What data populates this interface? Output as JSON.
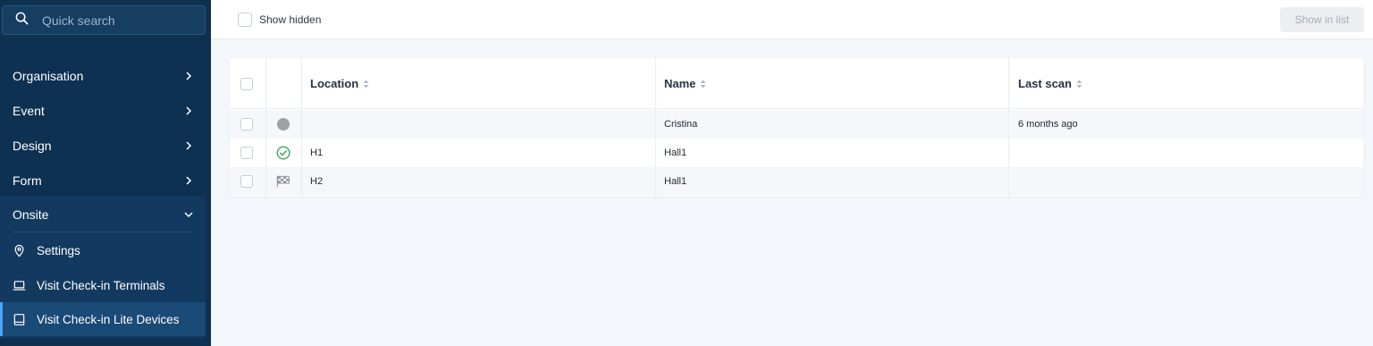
{
  "sidebar": {
    "search_placeholder": "Quick search",
    "nav": [
      {
        "label": "Organisation"
      },
      {
        "label": "Event"
      },
      {
        "label": "Design"
      },
      {
        "label": "Form"
      }
    ],
    "onsite": {
      "label": "Onsite",
      "items": [
        {
          "label": "Settings",
          "icon": "location-pin-icon"
        },
        {
          "label": "Visit Check-in Terminals",
          "icon": "laptop-icon"
        },
        {
          "label": "Visit Check-in Lite Devices",
          "icon": "tablet-icon",
          "active": true
        }
      ]
    }
  },
  "toolbar": {
    "show_hidden_label": "Show hidden",
    "show_hidden_checked": false,
    "show_in_list_label": "Show in list"
  },
  "table": {
    "columns": [
      "Location",
      "Name",
      "Last scan"
    ],
    "rows": [
      {
        "status": "offline-dot-icon",
        "location": "",
        "name": "Cristina",
        "last_scan": "6 months ago"
      },
      {
        "status": "check-circle-icon",
        "location": "H1",
        "name": "Hall1",
        "last_scan": ""
      },
      {
        "status": "flag-icon",
        "location": "H2",
        "name": "Hall1",
        "last_scan": ""
      }
    ]
  },
  "colors": {
    "sidebar_bg": "#0e3152",
    "active_accent": "#4ea3ff",
    "online_green": "#3fa55b",
    "offline_gray": "#9ea2a7"
  }
}
